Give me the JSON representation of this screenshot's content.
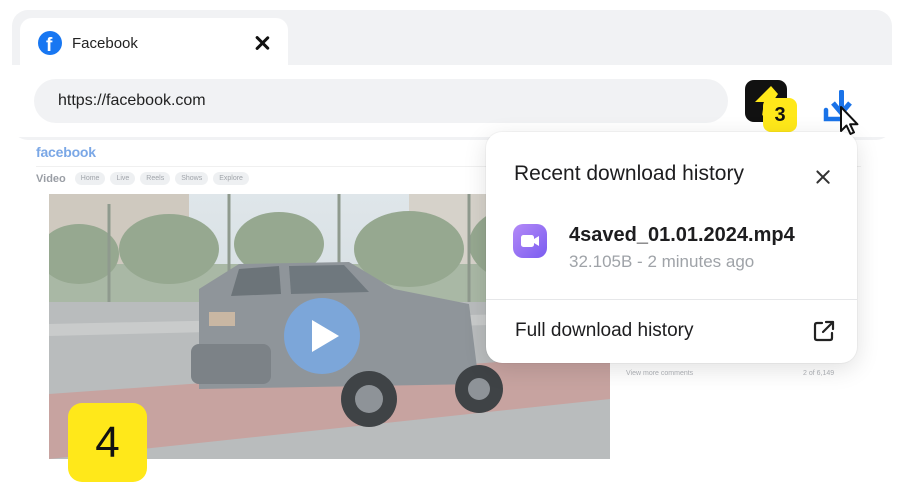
{
  "tab": {
    "title": "Facebook",
    "icon": "facebook-icon"
  },
  "address_bar": {
    "url": "https://facebook.com"
  },
  "extension": {
    "badge_count": "3",
    "icon": "extension-arrow-icon"
  },
  "download_button": {
    "icon": "download-icon"
  },
  "page": {
    "logo": "facebook",
    "video_label": "Video",
    "nav_items": [
      "Home",
      "Live",
      "Reels",
      "Shows",
      "Explore"
    ],
    "comments_link": "View more comments",
    "comments_count": "2 of 6,149"
  },
  "step_badge": "4",
  "download_popup": {
    "title": "Recent download history",
    "file": {
      "name": "4saved_01.01.2024.mp4",
      "meta": "32.105B - 2 minutes ago",
      "icon": "video-camera-icon"
    },
    "full_history_label": "Full download history"
  },
  "colors": {
    "facebook_blue": "#1877f2",
    "badge_yellow": "#ffe81a",
    "download_blue": "#1a73e8",
    "file_icon_purple": "#8b66f3"
  }
}
